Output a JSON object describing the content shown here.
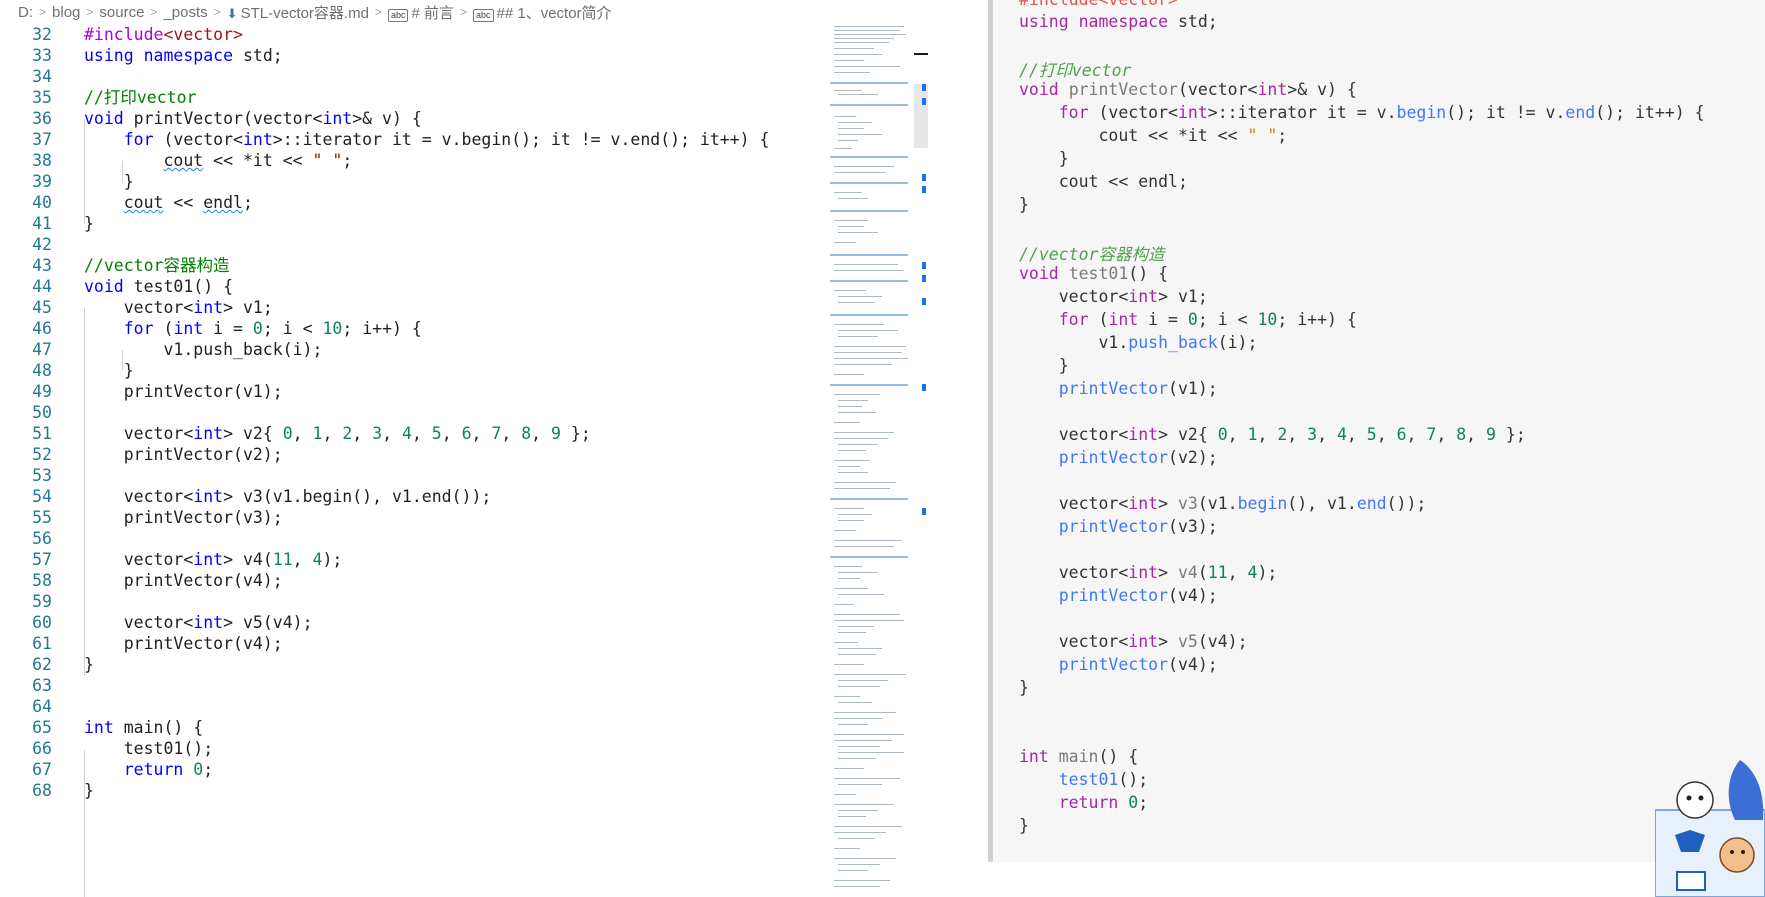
{
  "breadcrumb": {
    "items": [
      "D:",
      "blog",
      "source",
      "_posts",
      "STL-vector容器.md",
      "# 前言",
      "## 1、vector简介"
    ],
    "separator": ">"
  },
  "editor": {
    "line_numbers": [
      "32",
      "33",
      "34",
      "35",
      "36",
      "37",
      "38",
      "39",
      "40",
      "41",
      "42",
      "43",
      "44",
      "45",
      "46",
      "47",
      "48",
      "49",
      "50",
      "51",
      "52",
      "53",
      "54",
      "55",
      "56",
      "57",
      "58",
      "59",
      "60",
      "61",
      "62",
      "63",
      "64",
      "65",
      "66",
      "67",
      "68"
    ]
  },
  "preview": {
    "lines_count": 37
  },
  "colors": {
    "line_number": "#237893",
    "keyword": "#0000ff",
    "comment": "#008000",
    "number": "#098658",
    "string": "#a31515",
    "preview_background": "#f6f6f6"
  },
  "icons": [
    "markdown-file-icon",
    "heading-icon",
    "mascot-image"
  ]
}
